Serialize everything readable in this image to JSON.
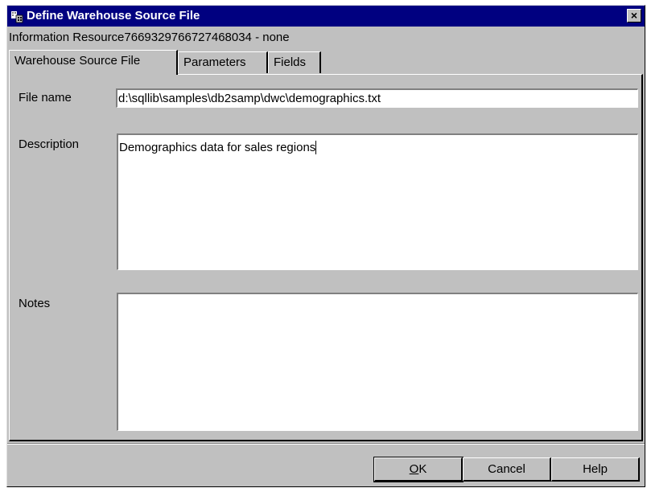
{
  "window": {
    "title": "Define Warehouse Source File",
    "close_glyph": "×",
    "icon": "warehouse-app-icon"
  },
  "info_line": "Information Resource7669329766727468034 - none",
  "tabs": [
    {
      "label": "Warehouse Source File",
      "active": true
    },
    {
      "label": "Parameters",
      "active": false
    },
    {
      "label": "Fields",
      "active": false
    }
  ],
  "form": {
    "file_name_label": "File name",
    "file_name_value": "d:\\sqllib\\samples\\db2samp\\dwc\\demographics.txt",
    "description_label": "Description",
    "description_value": "Demographics data for sales regions",
    "notes_label": "Notes",
    "notes_value": ""
  },
  "buttons": {
    "ok_mnemonic": "O",
    "ok_rest": "K",
    "cancel": "Cancel",
    "help": "Help"
  }
}
